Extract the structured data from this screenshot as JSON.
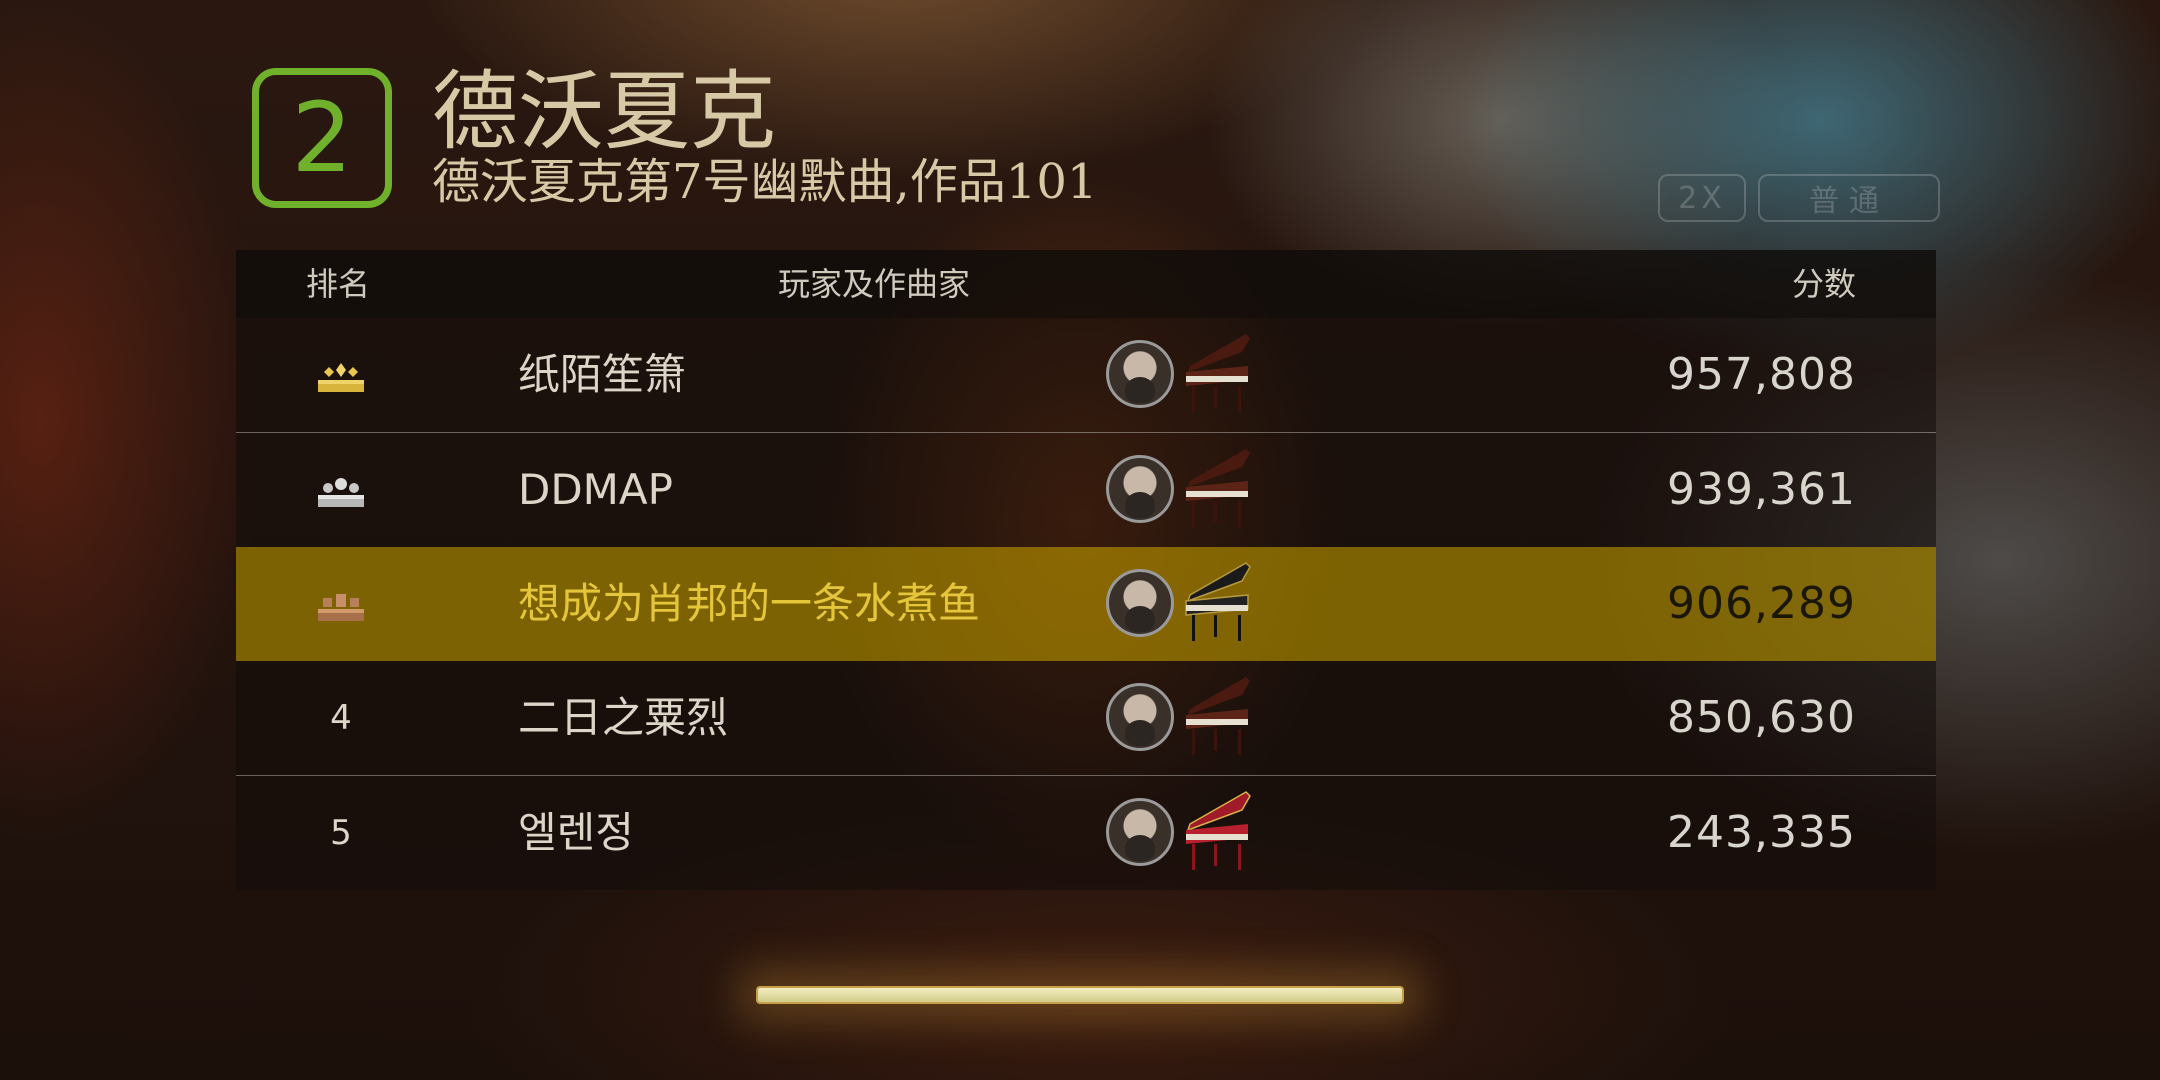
{
  "level": "2",
  "composer": "德沃夏克",
  "piece": "德沃夏克第7号幽默曲,作品101",
  "options": {
    "speed": "2X",
    "difficulty": "普通"
  },
  "table": {
    "headers": {
      "rank": "排名",
      "player": "玩家及作曲家",
      "score": "分数"
    },
    "rows": [
      {
        "rank": "1",
        "rank_icon": "gold-crown-icon",
        "name": "纸陌笙箫",
        "score": "957,808",
        "piano": "wood-piano",
        "highlight": false
      },
      {
        "rank": "2",
        "rank_icon": "silver-crown-icon",
        "name": "DDMAP",
        "score": "939,361",
        "piano": "wood-piano",
        "highlight": false
      },
      {
        "rank": "3",
        "rank_icon": "bronze-crown-icon",
        "name": "想成为肖邦的一条水煮鱼",
        "score": "906,289",
        "piano": "black-gold-piano",
        "highlight": true
      },
      {
        "rank": "4",
        "name": "二日之粟烈",
        "score": "850,630",
        "piano": "wood-piano",
        "highlight": false
      },
      {
        "rank": "5",
        "name": "엘렌정",
        "score": "243,335",
        "piano": "red-piano",
        "highlight": false
      }
    ]
  },
  "progress": 1.0,
  "colors": {
    "accent_green": "#6fb12b",
    "highlight_row": "#967800",
    "highlight_text": "#e5c53a",
    "gold": "#d8b43c",
    "silver": "#c8c8c8",
    "bronze": "#b47a4a"
  }
}
